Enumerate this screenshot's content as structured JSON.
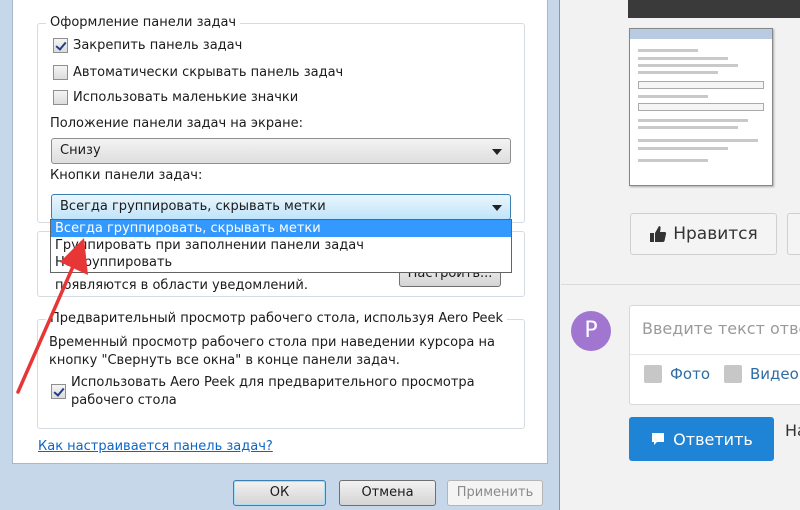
{
  "dialog": {
    "group_appearance": {
      "title": "Оформление панели задач",
      "lock_taskbar": {
        "label": "Закрепить панель задач",
        "checked": true
      },
      "auto_hide": {
        "label": "Автоматически скрывать панель задач",
        "checked": false
      },
      "small_icons": {
        "label": "Использовать маленькие значки",
        "checked": false
      },
      "position_label": "Положение панели задач на экране:",
      "position_value": "Снизу",
      "buttons_label": "Кнопки панели задач:",
      "buttons_value": "Всегда группировать, скрывать метки"
    },
    "dropdown_options": [
      "Всегда группировать, скрывать метки",
      "Группировать при заполнении панели задач",
      "Не группировать"
    ],
    "notification_area": {
      "text": "появляются в области уведомлений.",
      "configure_button": "Настроить..."
    },
    "aero_peek": {
      "title": "Предварительный просмотр рабочего стола, используя Aero Peek",
      "description_line1": "Временный просмотр рабочего стола при наведении курсора на",
      "description_line2": "кнопку \"Свернуть все окна\" в конце панели задач.",
      "checkbox_line1": "Использовать Aero Peek для предварительного просмотра",
      "checkbox_line2": "рабочего стола",
      "checked": true
    },
    "help_link": "Как настраивается панель задач?",
    "buttons": {
      "ok": "ОК",
      "cancel": "Отмена",
      "apply": "Применить"
    }
  },
  "page": {
    "like_button": "Нравится",
    "avatar_letter": "P",
    "comment_placeholder": "Введите текст отве",
    "attach_photo": "Фото",
    "attach_video": "Видео",
    "reply_button": "Ответить",
    "reply_tail": "На"
  },
  "colors": {
    "dropdown_selection": "#3399ff",
    "annotation_arrow": "#e63636",
    "reply_button": "#1f84d6",
    "avatar": "#a076d1",
    "link": "#0b66c7"
  }
}
